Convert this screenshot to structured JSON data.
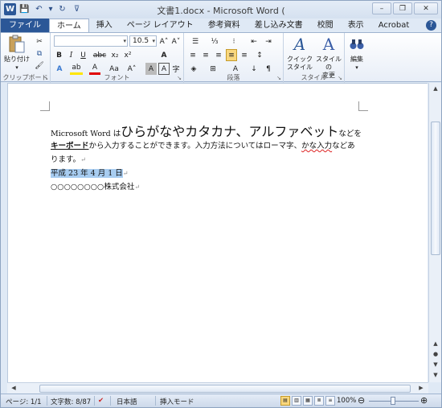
{
  "title": "文書1.docx - Microsoft Word (",
  "qat": {
    "logo": "W",
    "save": "💾",
    "undo": "↶",
    "undo_drop": "▾",
    "redo": "↻",
    "customize": "⊽"
  },
  "window_controls": {
    "minimize": "–",
    "restore": "❐",
    "close": "✕"
  },
  "tabs": [
    "ファイル",
    "ホーム",
    "挿入",
    "ページ レイアウト",
    "参考資料",
    "差し込み文書",
    "校閲",
    "表示",
    "Acrobat"
  ],
  "help": "?",
  "ribbon": {
    "clipboard": {
      "label": "クリップボード",
      "paste_label": "貼り付け",
      "cut": "✂",
      "copy": "⧉",
      "format_painter": "🖌"
    },
    "font": {
      "label": "フォント",
      "font_name": "",
      "font_size": "10.5",
      "grow": "A˄",
      "shrink": "A˅",
      "aa": "Aa",
      "clear": "A",
      "bold": "B",
      "italic": "I",
      "underline": "U",
      "strike": "abc",
      "subscript": "x₂",
      "superscript": "x²",
      "effects": "A",
      "highlight": "ab",
      "font_color": "A",
      "case": "Aa",
      "grow2": "A˄",
      "shading": "A",
      "border": "A",
      "enclose": "字"
    },
    "paragraph": {
      "label": "段落",
      "bullets": "☰",
      "numbering": "⅓",
      "multilevel": "⁝",
      "decrease_indent": "⇤",
      "increase_indent": "⇥",
      "align_left": "≡",
      "center": "≡",
      "align_right": "≡",
      "justify": "≡",
      "distribute": "≡",
      "line_spacing": "↕",
      "shading": "◈",
      "borders": "⊞",
      "sort": "↓",
      "show_marks": "¶",
      "asian_layout": "A"
    },
    "styles": {
      "label": "スタイル",
      "quick_style_1": "クイック",
      "quick_style_2": "スタイル",
      "change_style_1": "スタイルの",
      "change_style_2": "変更"
    },
    "editing": {
      "label": "編集"
    }
  },
  "document": {
    "line1_a": "Microsoft Word は",
    "line1_b": "ひらがなやカタカナ、アルファベット",
    "line1_c": "などを",
    "line2_a": "キーボード",
    "line2_b": "から入力することができます。入力方法についてはローマ字、",
    "line2_c": "かな入力",
    "line2_d": "などあ",
    "line3": "ります。",
    "line4": "平成 23 年 4 月 1 日",
    "line5": "○○○○○○○○株式会社",
    "para_mark": "↵"
  },
  "status": {
    "page": "ページ: 1/1",
    "words": "文字数: 8/87",
    "lang": "日本語",
    "mode": "挿入モード",
    "zoom": "100%",
    "zoom_out": "⊖",
    "zoom_in": "⊕"
  },
  "colors": {
    "accent": "#2b5797",
    "selection": "#a8cdf1"
  }
}
